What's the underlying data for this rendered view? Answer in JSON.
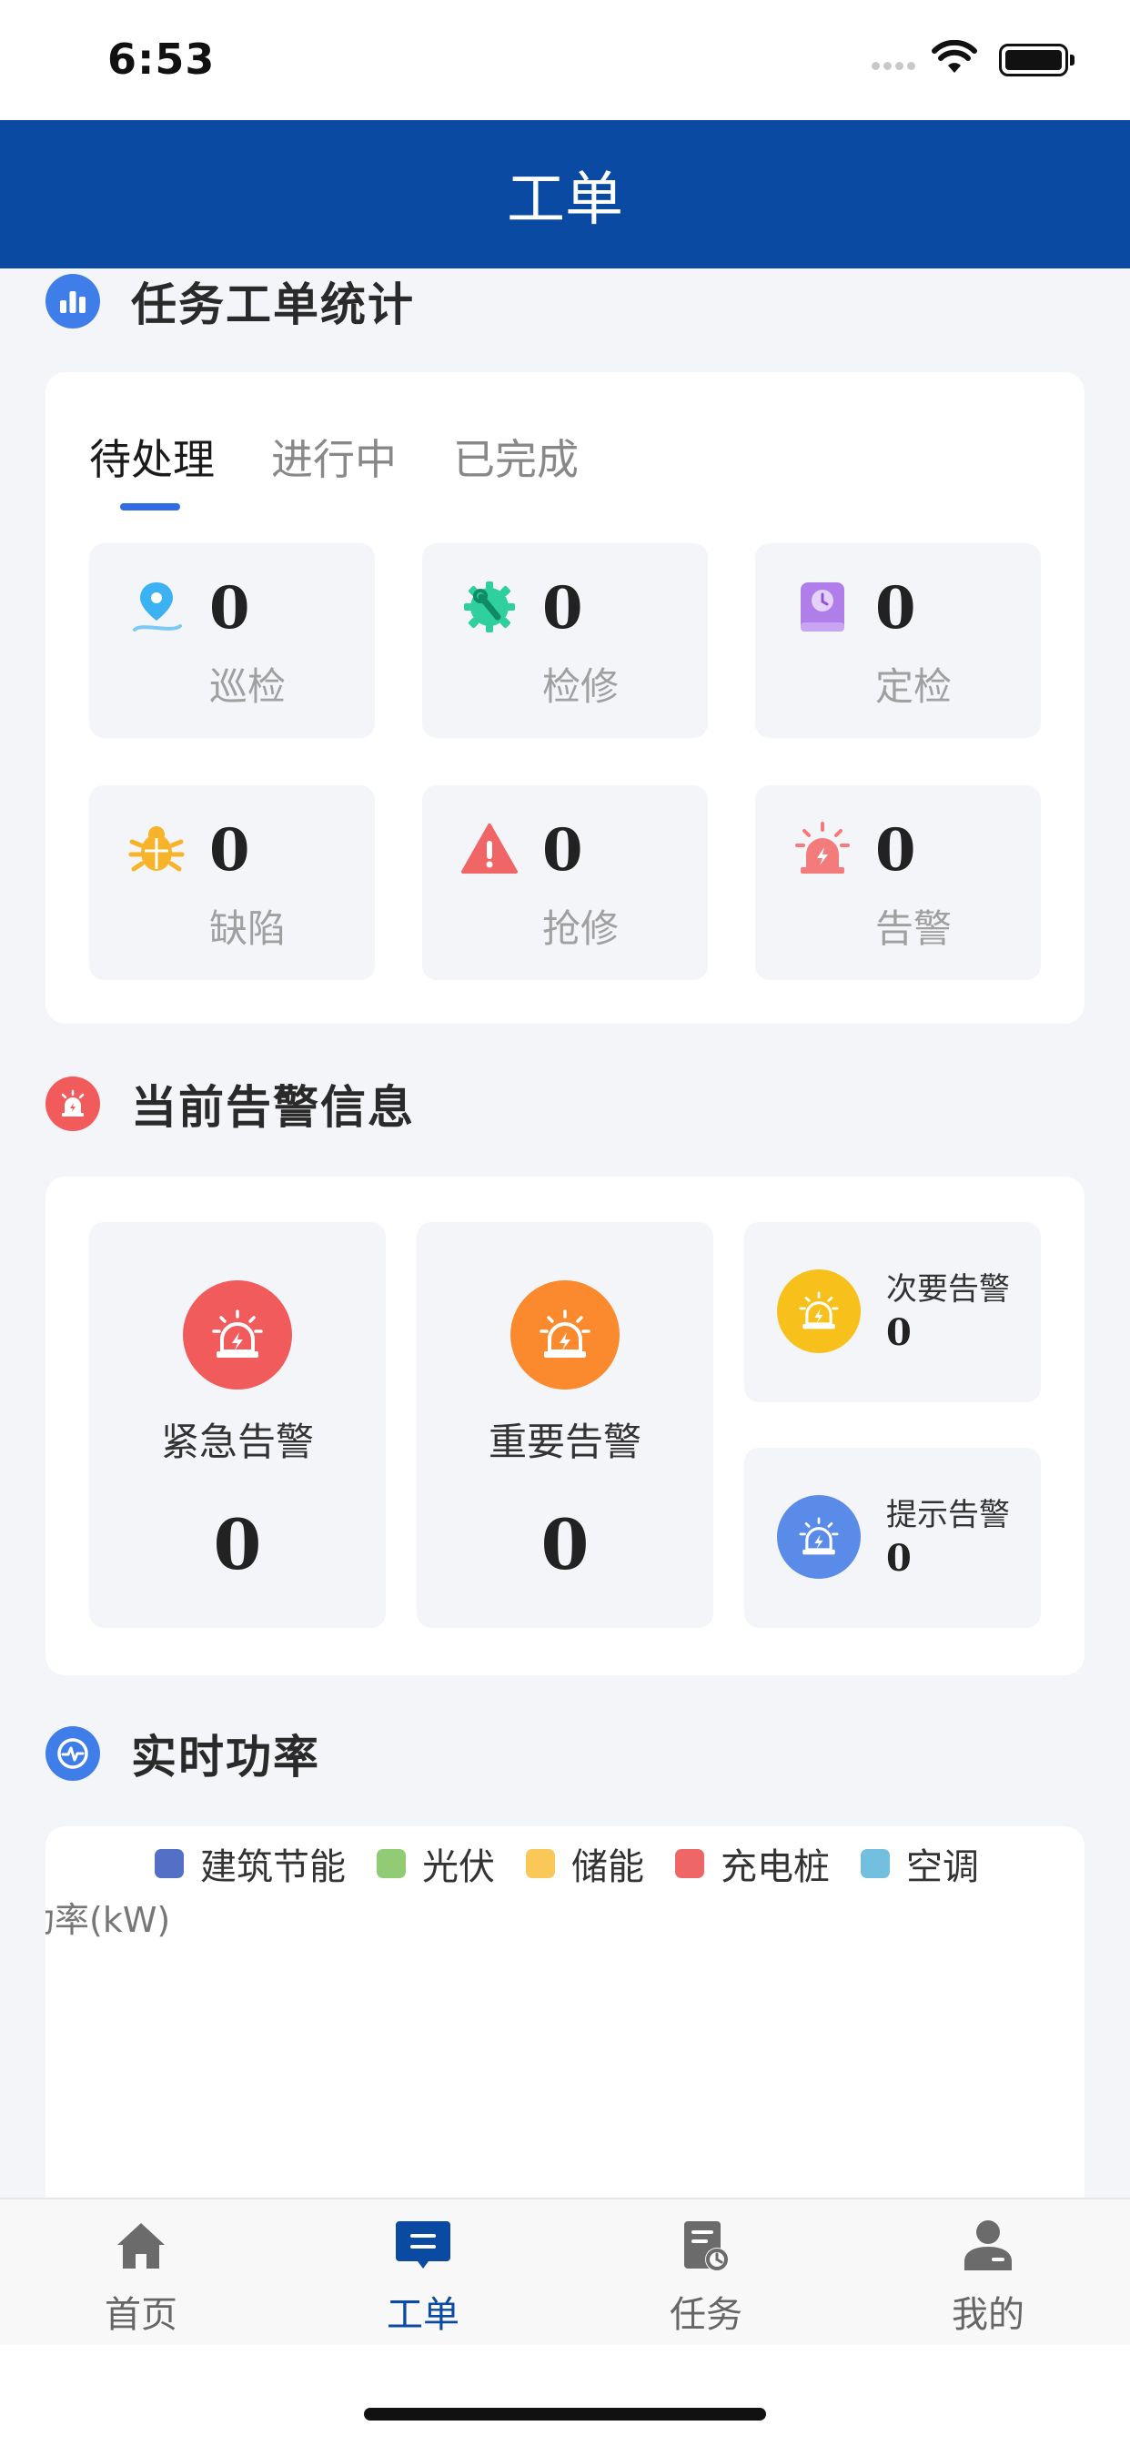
{
  "status_bar": {
    "time": "6:53"
  },
  "header": {
    "title": "工单"
  },
  "task_stats": {
    "title": "任务工单统计",
    "tabs": [
      {
        "label": "待处理",
        "active": true
      },
      {
        "label": "进行中",
        "active": false
      },
      {
        "label": "已完成",
        "active": false
      }
    ],
    "items": [
      {
        "label": "巡检",
        "value": "0",
        "icon": "location-pin-icon",
        "color": "#3db2f2"
      },
      {
        "label": "检修",
        "value": "0",
        "icon": "wrench-gear-icon",
        "color": "#2fcf9e"
      },
      {
        "label": "定检",
        "value": "0",
        "icon": "clock-book-icon",
        "color": "#b07ee8"
      },
      {
        "label": "缺陷",
        "value": "0",
        "icon": "bug-icon",
        "color": "#f7b329"
      },
      {
        "label": "抢修",
        "value": "0",
        "icon": "warning-triangle-icon",
        "color": "#f06565"
      },
      {
        "label": "告警",
        "value": "0",
        "icon": "siren-icon",
        "color": "#f47b7b"
      }
    ]
  },
  "alarms": {
    "title": "当前告警信息",
    "urgent": {
      "label": "紧急告警",
      "value": "0",
      "color": "#f25b5b"
    },
    "important": {
      "label": "重要告警",
      "value": "0",
      "color": "#fb8a2e"
    },
    "minor": {
      "label": "次要告警",
      "value": "0",
      "color": "#f8c01a"
    },
    "hint": {
      "label": "提示告警",
      "value": "0",
      "color": "#5b8be8"
    }
  },
  "power": {
    "title": "实时功率",
    "chart_data": {
      "type": "line",
      "ylabel": "功率(kW)",
      "series": [
        {
          "name": "建筑节能",
          "color": "#5470c6",
          "values": []
        },
        {
          "name": "光伏",
          "color": "#91cc75",
          "values": []
        },
        {
          "name": "储能",
          "color": "#fac858",
          "values": []
        },
        {
          "name": "充电桩",
          "color": "#ee6666",
          "values": []
        },
        {
          "name": "空调",
          "color": "#73c0de",
          "values": []
        }
      ]
    }
  },
  "tabbar": {
    "items": [
      {
        "label": "首页",
        "icon": "home-icon",
        "active": false
      },
      {
        "label": "工单",
        "icon": "work-order-icon",
        "active": true
      },
      {
        "label": "任务",
        "icon": "task-icon",
        "active": false
      },
      {
        "label": "我的",
        "icon": "user-icon",
        "active": false
      }
    ],
    "active_color": "#0b4aa2"
  }
}
